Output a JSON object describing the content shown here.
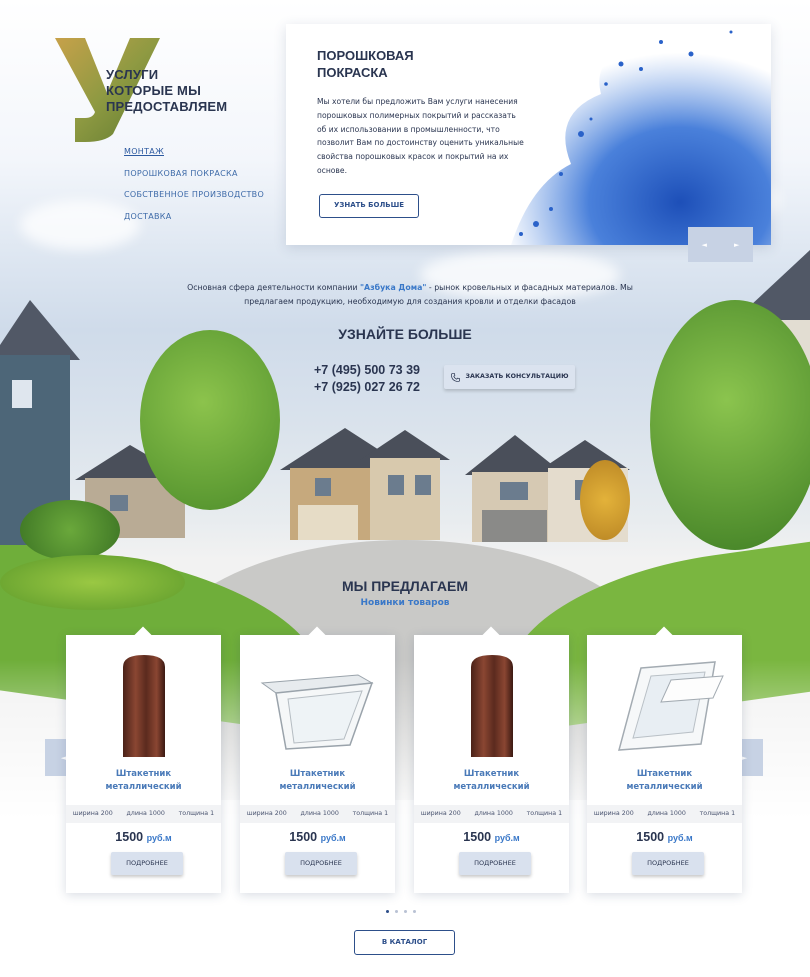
{
  "header": {
    "big_letter": "У",
    "services_title": "УСЛУГИ\nКОТОРЫЕ МЫ\nПРЕДОСТАВЛЯЕМ",
    "nav": [
      {
        "label": "МОНТАЖ",
        "active": true
      },
      {
        "label": "ПОРОШКОВАЯ ПОКРАСКА",
        "active": false
      },
      {
        "label": "СОБСТВЕННОЕ ПРОИЗВОДСТВО",
        "active": false
      },
      {
        "label": "ДОСТАВКА",
        "active": false
      }
    ]
  },
  "promo": {
    "title": "ПОРОШКОВАЯ\nПОКРАСКА",
    "text": "Мы хотели бы предложить Вам услуги нанесения порошковых полимерных покрытий и рассказать об их использовании в промышленности, что позволит Вам по достоинству оценить уникальные свойства порошковых красок и покрытий на их основе.",
    "button": "УЗНАТЬ БОЛЬШЕ",
    "prev_icon": "◄",
    "next_icon": "►",
    "splash_color": "#2a62c9"
  },
  "about": {
    "text_before": "Основная сфера деятельности компании ",
    "company": "\"Азбука Дома\"",
    "text_after": " - рынок кровельных и фасадных материалов. Мы предлагаем продукцию, необходимую для создания кровли и отделки фасадов"
  },
  "contact": {
    "title": "УЗНАЙТЕ БОЛЬШЕ",
    "phone1": "+7 (495) 500 73 39",
    "phone2": "+7 (925) 027 26 72",
    "consult_button": "ЗАКАЗАТЬ КОНСУЛЬТАЦИЮ"
  },
  "offers": {
    "title": "МЫ ПРЕДЛАГАЕМ",
    "subtitle": "Новинки товаров",
    "cards": [
      {
        "name": "Штакетник\nметаллический",
        "spec_width": "ширина 200",
        "spec_length": "длина 1000",
        "spec_thickness": "толщина 1",
        "price": "1500",
        "currency": "руб.м",
        "button": "ПОДРОБНЕЕ",
        "image": "picket"
      },
      {
        "name": "Штакетник\nметаллический",
        "spec_width": "ширина 200",
        "spec_length": "длина 1000",
        "spec_thickness": "толщина 1",
        "price": "1500",
        "currency": "руб.м",
        "button": "ПОДРОБНЕЕ",
        "image": "window"
      },
      {
        "name": "Штакетник\nметаллический",
        "spec_width": "ширина 200",
        "spec_length": "длина 1000",
        "spec_thickness": "толщина 1",
        "price": "1500",
        "currency": "руб.м",
        "button": "ПОДРОБНЕЕ",
        "image": "picket"
      },
      {
        "name": "Штакетник\nметаллический",
        "spec_width": "ширина 200",
        "spec_length": "длина 1000",
        "spec_thickness": "толщина 1",
        "price": "1500",
        "currency": "руб.м",
        "button": "ПОДРОБНЕЕ",
        "image": "window"
      }
    ],
    "prev_icon": "◄",
    "next_icon": "►",
    "dots": 4,
    "active_dot": 0,
    "catalog_button": "В КАТАЛОГ"
  },
  "colors": {
    "primary": "#2a3550",
    "accent": "#3a78c8",
    "button_bg": "#d9e1ee"
  }
}
